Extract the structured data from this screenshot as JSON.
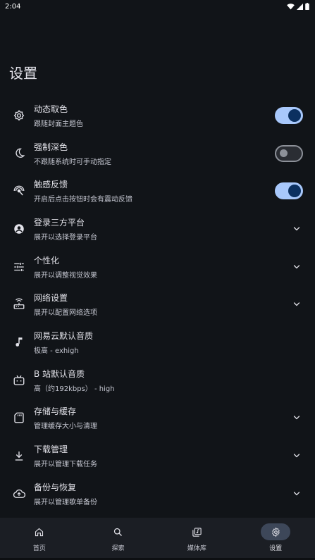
{
  "status_bar": {
    "time": "2:04"
  },
  "page": {
    "title": "设置"
  },
  "settings": [
    {
      "id": "dynamic-color",
      "icon": "brightness-auto-icon",
      "title": "动态取色",
      "subtitle": "跟随封面主题色",
      "control": "toggle",
      "checked": true
    },
    {
      "id": "force-dark",
      "icon": "moon-icon",
      "title": "强制深色",
      "subtitle": "不跟随系统时可手动指定",
      "control": "toggle",
      "checked": false
    },
    {
      "id": "haptic-feedback",
      "icon": "touch-icon",
      "title": "触感反馈",
      "subtitle": "开启后点击按钮时会有震动反馈",
      "control": "toggle",
      "checked": true
    },
    {
      "id": "third-party-login",
      "icon": "account-circle-icon",
      "title": "登录三方平台",
      "subtitle": "展开以选择登录平台",
      "control": "expand"
    },
    {
      "id": "personalize",
      "icon": "tune-icon",
      "title": "个性化",
      "subtitle": "展开以调整视觉效果",
      "control": "expand"
    },
    {
      "id": "network",
      "icon": "router-icon",
      "title": "网络设置",
      "subtitle": "展开以配置网络选项",
      "control": "expand"
    },
    {
      "id": "netease-quality",
      "icon": "music-note-icon",
      "title": "网易云默认音质",
      "subtitle": "极高 - exhigh",
      "control": "none"
    },
    {
      "id": "bilibili-quality",
      "icon": "bilibili-icon",
      "title": "B 站默认音质",
      "subtitle": "高（约192kbps） - high",
      "control": "none"
    },
    {
      "id": "storage-cache",
      "icon": "sd-card-icon",
      "title": "存储与缓存",
      "subtitle": "管理缓存大小与清理",
      "control": "expand"
    },
    {
      "id": "download-manager",
      "icon": "download-icon",
      "title": "下载管理",
      "subtitle": "展开以管理下载任务",
      "control": "expand"
    },
    {
      "id": "backup-restore",
      "icon": "cloud-upload-icon",
      "title": "备份与恢复",
      "subtitle": "展开以管理歌单备份",
      "control": "expand"
    }
  ],
  "bottom_nav": [
    {
      "id": "home",
      "icon": "home-icon",
      "label": "首页",
      "active": false
    },
    {
      "id": "explore",
      "icon": "search-icon",
      "label": "探索",
      "active": false
    },
    {
      "id": "library",
      "icon": "library-music-icon",
      "label": "媒体库",
      "active": false
    },
    {
      "id": "settings",
      "icon": "gear-icon",
      "label": "设置",
      "active": true
    }
  ],
  "colors": {
    "background": "#111418",
    "toggle_on_track": "#a8c8fb",
    "toggle_on_knob": "#0b3060",
    "nav_active_pill": "#3d4759"
  }
}
